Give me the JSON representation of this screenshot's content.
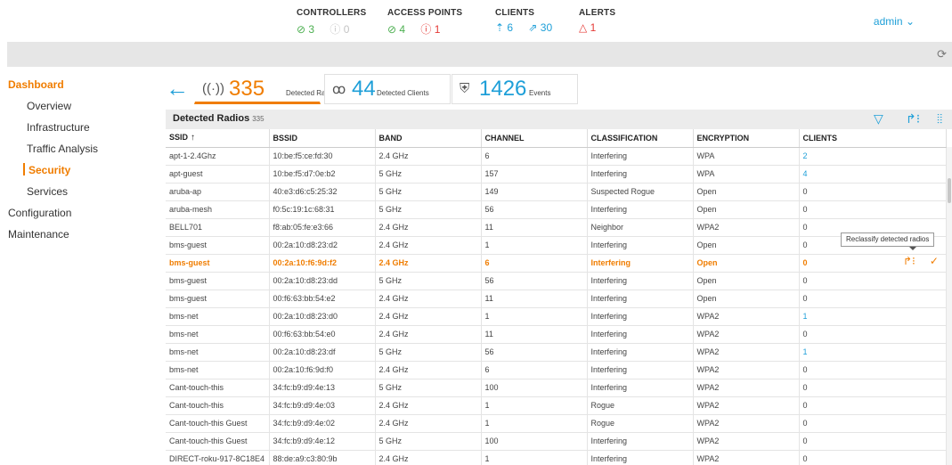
{
  "stats": {
    "controllers": {
      "title": "CONTROLLERS",
      "ok": "⊘ 3",
      "down": "ⓘ 0"
    },
    "access_points": {
      "title": "ACCESS POINTS",
      "ok": "⊘ 4",
      "down": "ⓘ 1"
    },
    "clients": {
      "title": "CLIENTS",
      "wireless": "⇡ 6",
      "wired": "⇗ 30"
    },
    "alerts": {
      "title": "ALERTS",
      "count": "△ 1"
    }
  },
  "user": {
    "name": "admin ⌄"
  },
  "sidebar": {
    "dashboard": "Dashboard",
    "items": [
      "Overview",
      "Infrastructure",
      "Traffic Analysis",
      "Security",
      "Services"
    ],
    "configuration": "Configuration",
    "maintenance": "Maintenance"
  },
  "tabs": {
    "radios": {
      "count": "335",
      "label": "Detected Radios"
    },
    "clients": {
      "count": "44",
      "label": "Detected Clients"
    },
    "events": {
      "count": "1426",
      "label": "Events"
    }
  },
  "panel": {
    "title": "Detected Radios",
    "count": "335"
  },
  "table": {
    "headers": [
      "SSID",
      "BSSID",
      "BAND",
      "CHANNEL",
      "CLASSIFICATION",
      "ENCRYPTION",
      "CLIENTS"
    ],
    "rows": [
      [
        "apt-1-2.4Ghz",
        "10:be:f5:ce:fd:30",
        "2.4 GHz",
        "6",
        "Interfering",
        "WPA",
        "2"
      ],
      [
        "apt-guest",
        "10:be:f5:d7:0e:b2",
        "5 GHz",
        "157",
        "Interfering",
        "WPA",
        "4"
      ],
      [
        "aruba-ap",
        "40:e3:d6:c5:25:32",
        "5 GHz",
        "149",
        "Suspected Rogue",
        "Open",
        "0"
      ],
      [
        "aruba-mesh",
        "f0:5c:19:1c:68:31",
        "5 GHz",
        "56",
        "Interfering",
        "Open",
        "0"
      ],
      [
        "BELL701",
        "f8:ab:05:fe:e3:66",
        "2.4 GHz",
        "11",
        "Neighbor",
        "WPA2",
        "0"
      ],
      [
        "bms-guest",
        "00:2a:10:d8:23:d2",
        "2.4 GHz",
        "1",
        "Interfering",
        "Open",
        "0"
      ],
      [
        "bms-guest",
        "00:2a:10:f6:9d:f2",
        "2.4 GHz",
        "6",
        "Interfering",
        "Open",
        "0"
      ],
      [
        "bms-guest",
        "00:2a:10:d8:23:dd",
        "5 GHz",
        "56",
        "Interfering",
        "Open",
        "0"
      ],
      [
        "bms-guest",
        "00:f6:63:bb:54:e2",
        "2.4 GHz",
        "11",
        "Interfering",
        "Open",
        "0"
      ],
      [
        "bms-net",
        "00:2a:10:d8:23:d0",
        "2.4 GHz",
        "1",
        "Interfering",
        "WPA2",
        "1"
      ],
      [
        "bms-net",
        "00:f6:63:bb:54:e0",
        "2.4 GHz",
        "11",
        "Interfering",
        "WPA2",
        "0"
      ],
      [
        "bms-net",
        "00:2a:10:d8:23:df",
        "5 GHz",
        "56",
        "Interfering",
        "WPA2",
        "1"
      ],
      [
        "bms-net",
        "00:2a:10:f6:9d:f0",
        "2.4 GHz",
        "6",
        "Interfering",
        "WPA2",
        "0"
      ],
      [
        "Cant-touch-this",
        "34:fc:b9:d9:4e:13",
        "5 GHz",
        "100",
        "Interfering",
        "WPA2",
        "0"
      ],
      [
        "Cant-touch-this",
        "34:fc:b9:d9:4e:03",
        "2.4 GHz",
        "1",
        "Rogue",
        "WPA2",
        "0"
      ],
      [
        "Cant-touch-this Guest",
        "34:fc:b9:d9:4e:02",
        "2.4 GHz",
        "1",
        "Rogue",
        "WPA2",
        "0"
      ],
      [
        "Cant-touch-this Guest",
        "34:fc:b9:d9:4e:12",
        "5 GHz",
        "100",
        "Interfering",
        "WPA2",
        "0"
      ],
      [
        "DIRECT-roku-917-8C18E4",
        "88:de:a9:c3:80:9b",
        "2.4 GHz",
        "1",
        "Interfering",
        "WPA2",
        "0"
      ]
    ],
    "highlighted_row": 6,
    "blue_client_rows": [
      0,
      1,
      9,
      11
    ]
  },
  "tooltip": {
    "text": "Reclassify detected radios"
  },
  "colors": {
    "accent": "#f07d00",
    "link": "#1e9fd8",
    "ok": "#4caf50",
    "bad": "#e53935"
  },
  "icons": {
    "back": "arrow-left-icon",
    "radio": "radio-signal-icon",
    "clients": "users-icon",
    "events": "shield-icon",
    "filter": "filter-icon",
    "reclassify": "reclassify-icon",
    "columns": "columns-icon",
    "refresh": "refresh-icon",
    "confirm": "check-icon"
  }
}
